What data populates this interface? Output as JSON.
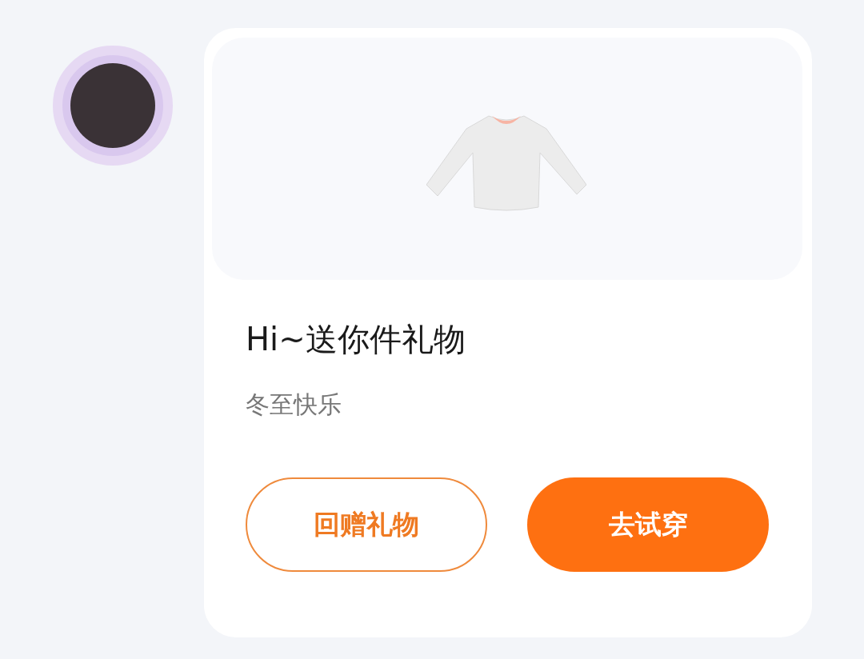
{
  "gift_card": {
    "title": "Hi~送你件礼物",
    "subtitle": "冬至快乐",
    "buttons": [
      {
        "label": "回赠礼物",
        "kind": "outline"
      },
      {
        "label": "去试穿",
        "kind": "filled"
      }
    ]
  }
}
